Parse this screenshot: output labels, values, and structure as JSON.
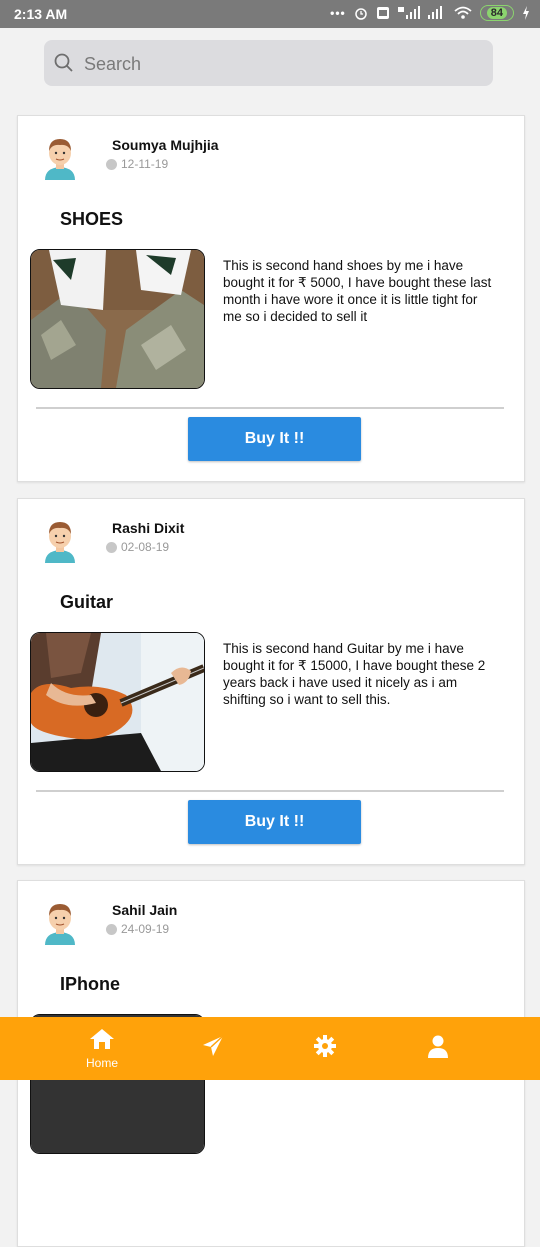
{
  "status_bar": {
    "time": "2:13 AM",
    "dots": "•••",
    "battery": "84"
  },
  "search": {
    "placeholder": "Search"
  },
  "posts": [
    {
      "user": "Soumya Mujhjia",
      "date": "12-11-19",
      "title": "SHOES",
      "description": "This is second hand shoes by me i have bought it for ₹ 5000, I have bought these last month i have wore it once it is little tight for me so i decided to sell it",
      "button": "Buy It !!"
    },
    {
      "user": "Rashi Dixit",
      "date": "02-08-19",
      "title": "Guitar",
      "description": "This is second hand  Guitar by me i have bought it for ₹ 15000, I have bought these 2 years back i have used it nicely as i am shifting so i want to sell this.",
      "button": "Buy It !!"
    },
    {
      "user": "Sahil Jain",
      "date": "24-09-19",
      "title": "IPhone"
    }
  ],
  "bottom_nav": {
    "items": [
      {
        "label": "Home",
        "icon": "home-icon"
      },
      {
        "label": "",
        "icon": "send-icon"
      },
      {
        "label": "",
        "icon": "gear-icon"
      },
      {
        "label": "",
        "icon": "person-icon"
      }
    ]
  },
  "colors": {
    "accent_nav": "#ffa20a",
    "button": "#2a8be0",
    "status_bar": "#7a7a7a"
  }
}
